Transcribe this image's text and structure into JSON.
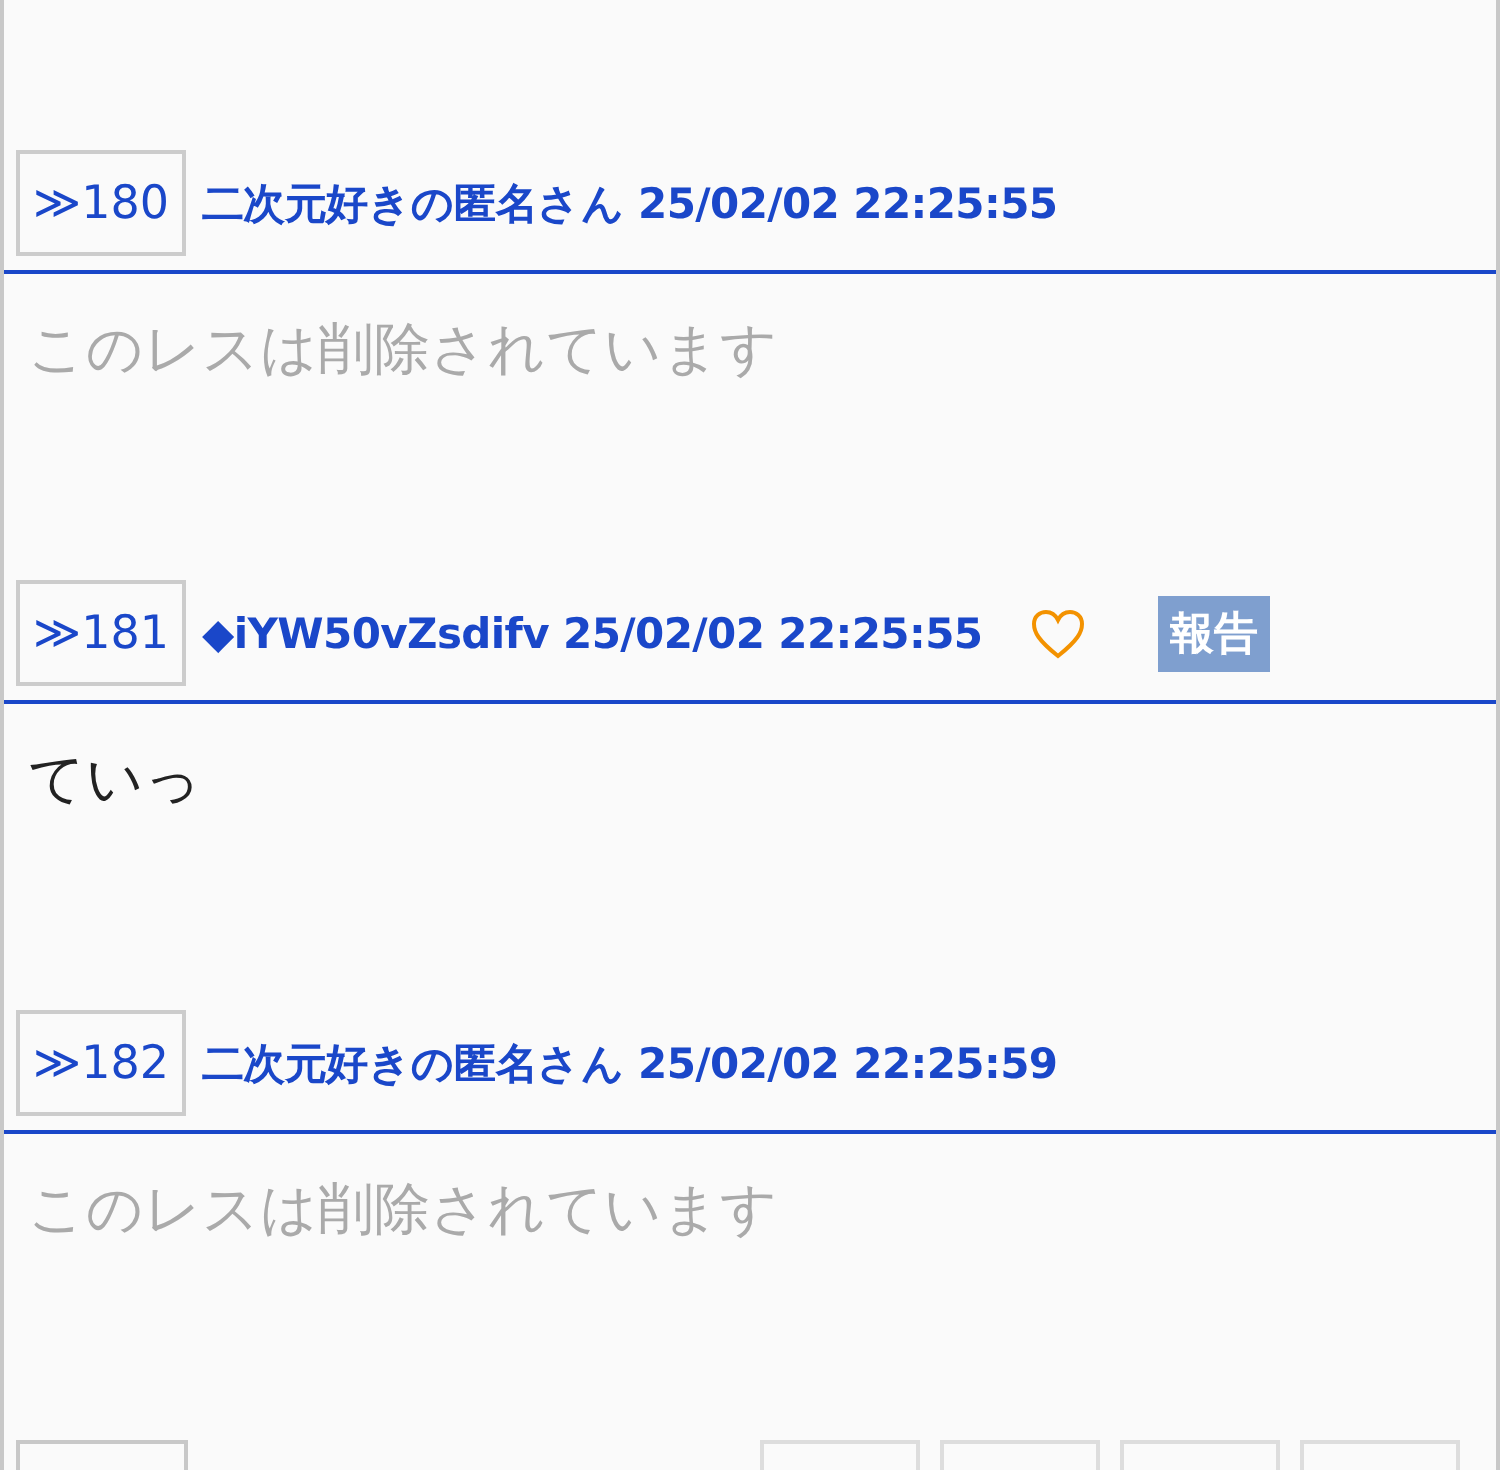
{
  "posts": [
    {
      "number": "≫180",
      "author": "二次元好きの匿名さん",
      "date": "25/02/02 22:25:55",
      "deleted": true,
      "body": "このレスは削除されています"
    },
    {
      "number": "≫181",
      "author": "◆iYW50vZsdifv",
      "date": "25/02/02 22:25:55",
      "deleted": false,
      "liked": false,
      "report": "報告",
      "body": "ていっ"
    },
    {
      "number": "≫182",
      "author": "二次元好きの匿名さん",
      "date": "25/02/02 22:25:59",
      "deleted": true,
      "body": "このレスは削除されています"
    }
  ]
}
